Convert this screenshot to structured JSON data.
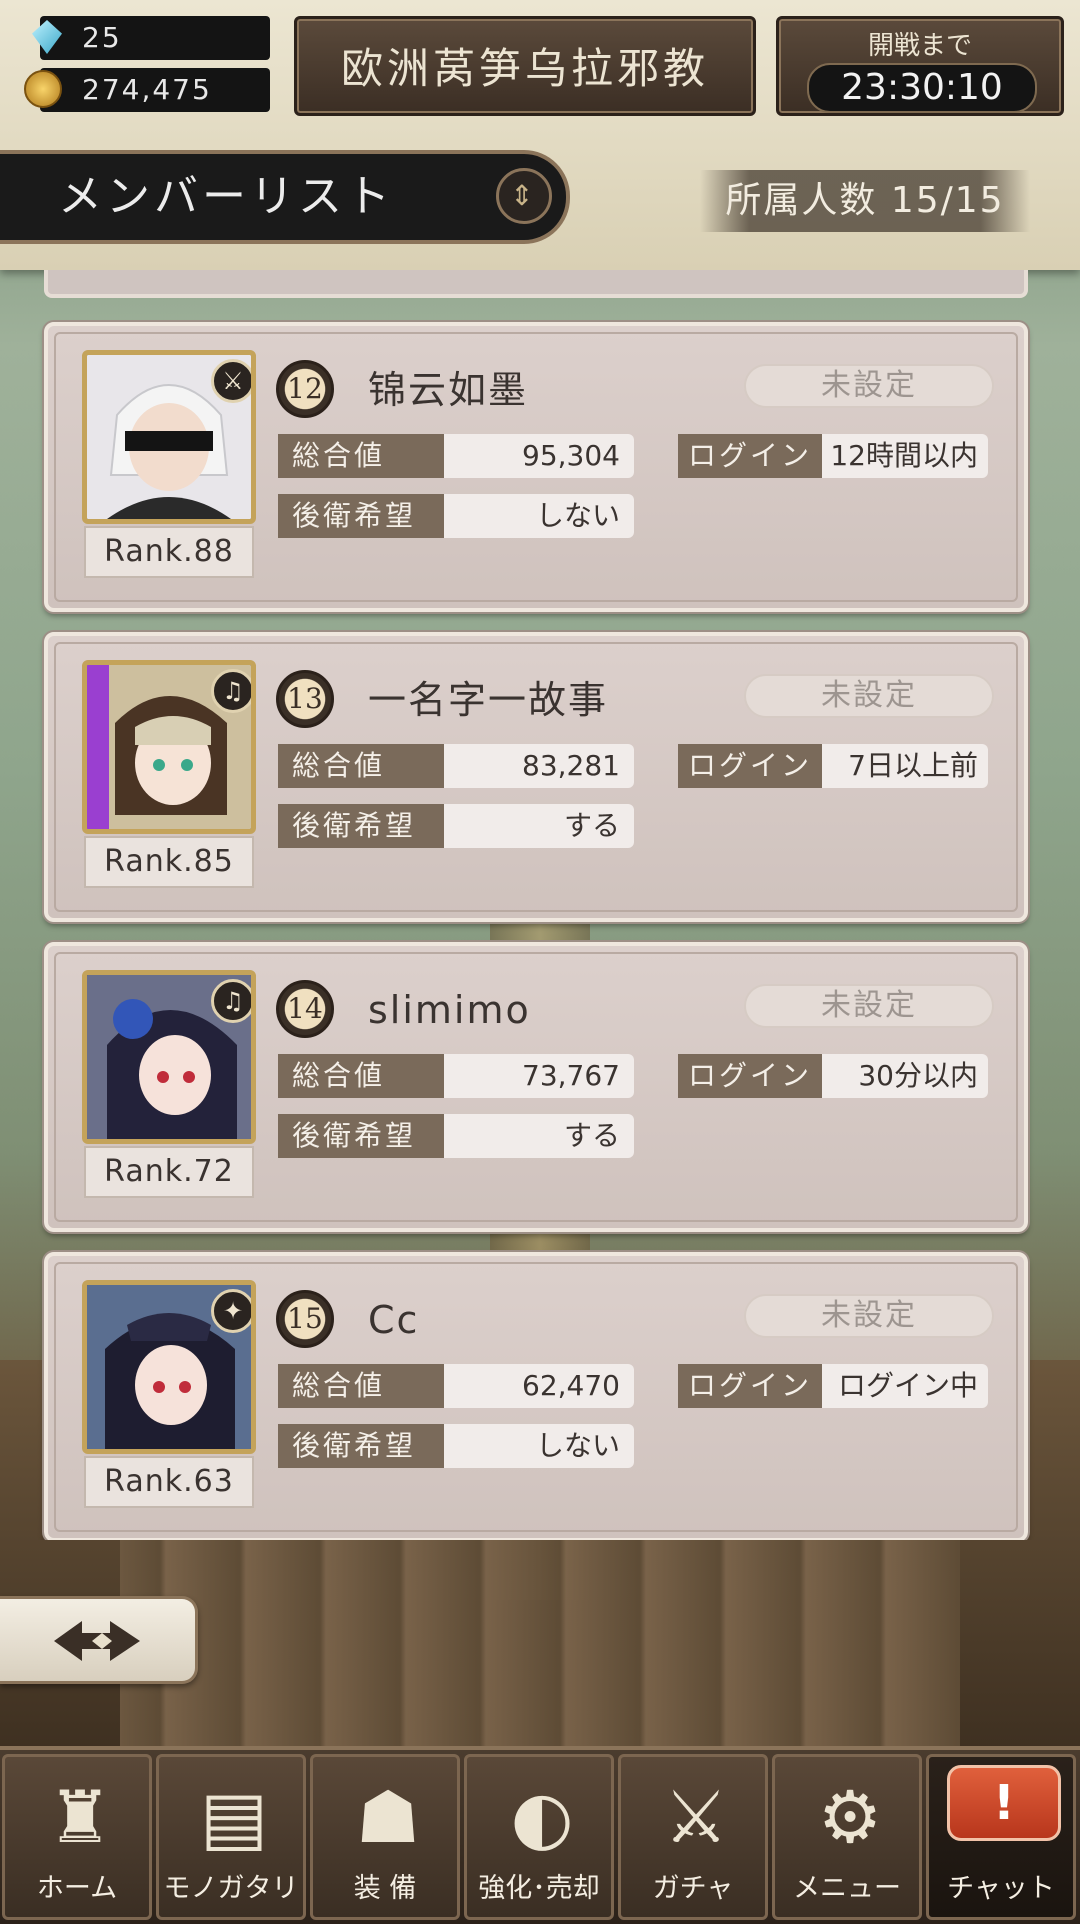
{
  "currency": {
    "gems": "25",
    "gold": "274,475"
  },
  "guild_name": "欧洲莴笋乌拉邪教",
  "battle": {
    "label": "開戦まで",
    "time": "23:30:10"
  },
  "member_list": {
    "title": "メンバーリスト",
    "count": "所属人数 15/15"
  },
  "labels": {
    "total": "総合値",
    "login": "ログイン",
    "rear": "後衛希望"
  },
  "members": [
    {
      "rank_num": "12",
      "name": "锦云如墨",
      "status": "未設定",
      "total": "95,304",
      "login": "12時間以内",
      "rear": "しない",
      "rank": "Rank.88",
      "weapon_icon": "sword-icon"
    },
    {
      "rank_num": "13",
      "name": "一名字一故事",
      "status": "未設定",
      "total": "83,281",
      "login": "7日以上前",
      "rear": "する",
      "rank": "Rank.85",
      "weapon_icon": "harp-icon"
    },
    {
      "rank_num": "14",
      "name": "slimimo",
      "status": "未設定",
      "total": "73,767",
      "login": "30分以内",
      "rear": "する",
      "rank": "Rank.72",
      "weapon_icon": "harp-icon"
    },
    {
      "rank_num": "15",
      "name": "Cc",
      "status": "未設定",
      "total": "62,470",
      "login": "ログイン中",
      "rear": "しない",
      "rank": "Rank.63",
      "weapon_icon": "staff-icon"
    }
  ],
  "nav": {
    "home": "ホーム",
    "story": "モノガタリ",
    "equip": "装 備",
    "enhance": "強化･売却",
    "gacha": "ガチャ",
    "menu": "メニュー",
    "chat": "チャット"
  },
  "colors": {
    "accent": "#8b745a",
    "card_bg": "#d6cac5",
    "chat_alert": "#d24e2c"
  }
}
